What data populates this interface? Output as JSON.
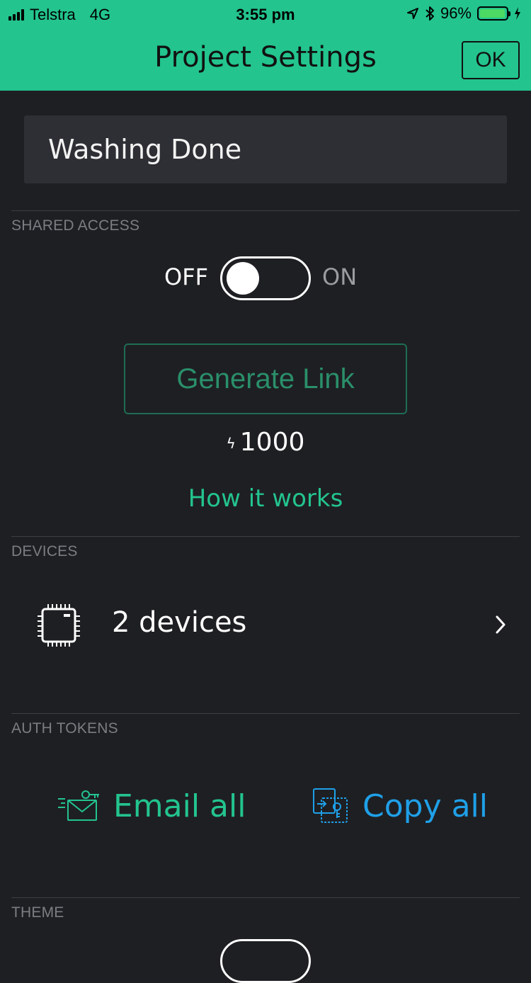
{
  "status_bar": {
    "carrier": "Telstra",
    "network": "4G",
    "time": "3:55 pm",
    "battery_percent": "96%",
    "battery_level": 0.96,
    "icons": [
      "signal-bars-icon",
      "location-arrow-icon",
      "bluetooth-icon",
      "battery-icon",
      "charging-bolt-icon"
    ]
  },
  "header": {
    "title": "Project Settings",
    "ok_label": "OK"
  },
  "project": {
    "name": "Washing Done"
  },
  "shared_access": {
    "section_label": "SHARED ACCESS",
    "off_label": "OFF",
    "on_label": "ON",
    "enabled": false,
    "generate_link_label": "Generate Link",
    "cost": "1000",
    "how_it_works_label": "How it works"
  },
  "devices": {
    "section_label": "DEVICES",
    "summary": "2 devices"
  },
  "auth_tokens": {
    "section_label": "AUTH TOKENS",
    "email_all_label": "Email all",
    "copy_all_label": "Copy all"
  },
  "theme": {
    "section_label": "THEME"
  },
  "colors": {
    "accent_green": "#23c48e",
    "accent_blue": "#1fa0e8",
    "background": "#1e1f23",
    "field_background": "#2e2f34"
  }
}
